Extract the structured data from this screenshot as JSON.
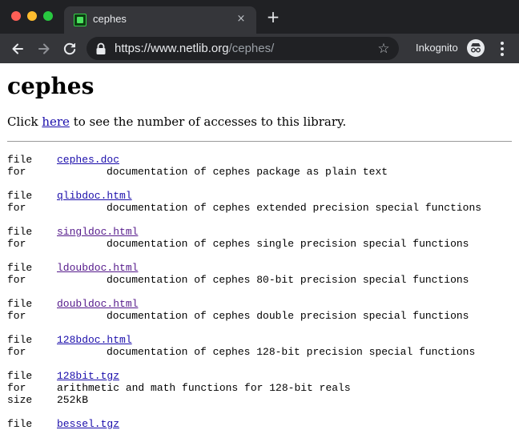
{
  "browser": {
    "tab_title": "cephes",
    "tab_close_glyph": "×",
    "new_tab_glyph": "+",
    "url_host": "https://www.netlib.org",
    "url_path": "/cephes/",
    "star_glyph": "☆",
    "incognito_label": "Inkognito",
    "icons": {
      "back": "back-arrow-icon",
      "forward": "forward-arrow-icon",
      "reload": "reload-icon",
      "lock": "lock-icon",
      "bookmark": "star-icon",
      "incognito": "incognito-icon",
      "menu": "more-vert-icon"
    }
  },
  "page": {
    "title": "cephes",
    "intro_before": "Click ",
    "intro_link": "here",
    "intro_after": " to see the number of accesses to this library.",
    "key_file": "file",
    "key_for": "for",
    "key_size": "size",
    "entries": [
      {
        "file": "cephes.doc",
        "for": "documentation of cephes package as plain text"
      },
      {
        "file": "qlibdoc.html",
        "for": "documentation of cephes extended precision special functions"
      },
      {
        "file": "singldoc.html",
        "for": "documentation of cephes single precision special functions"
      },
      {
        "file": "ldoubdoc.html",
        "for": "documentation of cephes 80-bit precision special functions"
      },
      {
        "file": "doubldoc.html",
        "for": "documentation of cephes double precision special functions"
      },
      {
        "file": "128bdoc.html",
        "for": "documentation of cephes 128-bit precision special functions"
      },
      {
        "file": "128bit.tgz",
        "for": "arithmetic and math functions for 128-bit reals",
        "size": "252kB"
      },
      {
        "file": "bessel.tgz"
      }
    ]
  },
  "colors": {
    "chrome_dark": "#202124",
    "chrome_tab": "#35363a",
    "link": "#1a0dab",
    "visited_link": "#551a8b"
  }
}
